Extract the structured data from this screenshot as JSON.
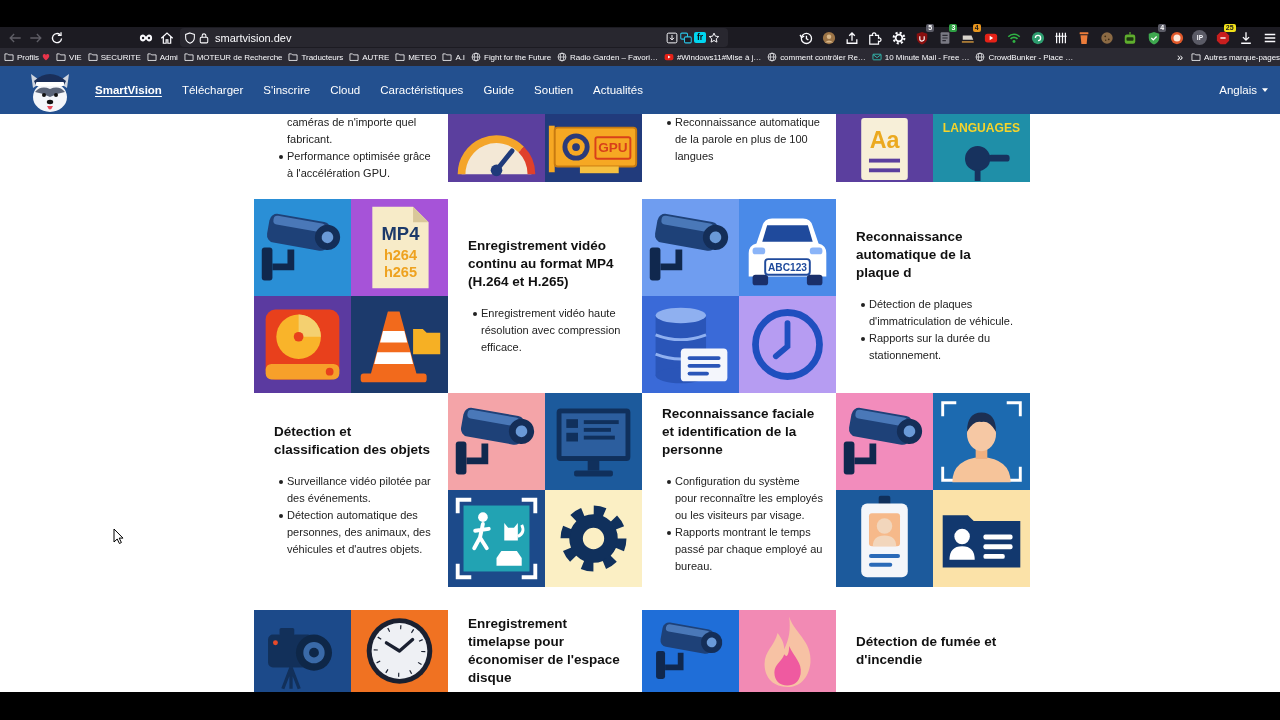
{
  "browser": {
    "toolbar": {
      "nav_buttons": [
        {
          "kind": "back",
          "disabled": true
        },
        {
          "kind": "forward",
          "disabled": true
        },
        {
          "kind": "reload",
          "disabled": false
        }
      ],
      "address": {
        "url": "smartvision.dev",
        "language_badge": "fr"
      },
      "extensions": [
        {
          "kind": "history"
        },
        {
          "kind": "avatar"
        },
        {
          "kind": "upload"
        },
        {
          "kind": "puzzle"
        },
        {
          "kind": "gear"
        },
        {
          "kind": "shield",
          "badge": {
            "text": "5",
            "color": "#5b5b66"
          }
        },
        {
          "kind": "document",
          "badge": {
            "text": "3",
            "color": "#2ea043"
          }
        },
        {
          "kind": "sled",
          "badge": {
            "text": "4",
            "color": "#e8961e"
          }
        },
        {
          "kind": "play"
        },
        {
          "kind": "wifi"
        },
        {
          "kind": "refresh"
        },
        {
          "kind": "bars"
        },
        {
          "kind": "trash"
        },
        {
          "kind": "cookie"
        },
        {
          "kind": "robot"
        },
        {
          "kind": "shieldcheck",
          "badge": {
            "text": "4",
            "color": "#5b5b66"
          }
        },
        {
          "kind": "ring"
        },
        {
          "kind": "text",
          "text": "IP"
        },
        {
          "kind": "stop",
          "badge": {
            "text": "25",
            "color": "#f2e21a"
          }
        },
        {
          "kind": "download"
        },
        {
          "kind": "menu"
        }
      ]
    },
    "bookmarks": {
      "items": [
        {
          "kind": "markedfolder",
          "label": "Profils"
        },
        {
          "kind": "folder",
          "label": "VIE"
        },
        {
          "kind": "folder",
          "label": "SECURITE"
        },
        {
          "kind": "folder",
          "label": "Admi"
        },
        {
          "kind": "folder",
          "label": "MOTEUR de Recherche"
        },
        {
          "kind": "folder",
          "label": "Traducteurs"
        },
        {
          "kind": "folder",
          "label": "AUTRE"
        },
        {
          "kind": "folder",
          "label": "METEO"
        },
        {
          "kind": "folder",
          "label": "A.I"
        },
        {
          "kind": "globe",
          "label": "Fight for the Future"
        },
        {
          "kind": "globe",
          "label": "Radio Garden – Favori…"
        },
        {
          "kind": "video",
          "label": "#Windows11#Mise à j…"
        },
        {
          "kind": "globe",
          "label": "comment contrôler Re…"
        },
        {
          "kind": "mail",
          "label": "10 Minute Mail - Free …"
        },
        {
          "kind": "globe",
          "label": "CrowdBunker - Place …"
        }
      ],
      "overflow": "»",
      "other_folder": "Autres marque-pages"
    }
  },
  "site": {
    "nav": {
      "items": [
        {
          "label": "SmartVision",
          "selected": true
        },
        {
          "label": "Télécharger",
          "selected": false
        },
        {
          "label": "S'inscrire",
          "selected": false
        },
        {
          "label": "Cloud",
          "selected": false
        },
        {
          "label": "Caractéristiques",
          "selected": false
        },
        {
          "label": "Guide",
          "selected": false
        },
        {
          "label": "Soutien",
          "selected": false
        },
        {
          "label": "Actualités",
          "selected": false
        }
      ],
      "language": "Anglais"
    },
    "feature_rows": [
      {
        "cells": [
          {
            "kind": "text",
            "continued": "caméras de n'importe quel fabricant.",
            "bullets": [
              "Performance optimisée grâce à l'accélération GPU."
            ]
          },
          {
            "kind": "image",
            "tiles": [
              {
                "kind": "gauge",
                "color": "#5b3f9e"
              },
              {
                "kind": "gpu",
                "color": "#213b7c",
                "texts": [
                  "GPU"
                ]
              }
            ]
          },
          {
            "kind": "text",
            "bullets": [
              "Reconnaissance automatique de la parole en plus de 100 langues"
            ]
          },
          {
            "kind": "image",
            "tiles": [
              {
                "kind": "document",
                "color": "#5b3f9e",
                "texts": [
                  "Aa"
                ]
              },
              {
                "kind": "microphone",
                "color": "#1f8fa8",
                "texts": [
                  "LANGUAGES"
                ]
              }
            ]
          }
        ]
      },
      {
        "cells": [
          {
            "kind": "image",
            "tiles": [
              {
                "kind": "camera",
                "color": "#2a8fd6"
              },
              {
                "kind": "file",
                "color": "#a653d8",
                "texts": [
                  "MP4",
                  "h264",
                  "h265"
                ]
              },
              {
                "kind": "harddrive",
                "color": "#5b3aa0"
              },
              {
                "kind": "cone",
                "color": "#1c3a6c"
              }
            ]
          },
          {
            "kind": "text",
            "title": "Enregistrement vidéo continu au format MP4 (H.264 et H.265)",
            "bullets": [
              "Enregistrement vidéo haute résolution avec compression efficace."
            ]
          },
          {
            "kind": "image",
            "tiles": [
              {
                "kind": "camera",
                "color": "#6f9df0"
              },
              {
                "kind": "car",
                "color": "#4a8ae8",
                "texts": [
                  "ABC123"
                ]
              },
              {
                "kind": "database",
                "color": "#3a6ad8"
              },
              {
                "kind": "clock",
                "color": "#b69cf2"
              }
            ]
          },
          {
            "kind": "text",
            "title": "Reconnaissance automatique de la plaque d",
            "bullets": [
              "Détection de plaques d'immatriculation de véhicule.",
              "Rapports sur la durée du stationnement."
            ]
          }
        ]
      },
      {
        "cells": [
          {
            "kind": "text",
            "title": "Détection et classification des objets",
            "bullets": [
              "Surveillance vidéo pilotée par des événements.",
              "Détection automatique des personnes, des animaux, des véhicules et d'autres objets."
            ]
          },
          {
            "kind": "image",
            "tiles": [
              {
                "kind": "camera",
                "color": "#f4a4a8"
              },
              {
                "kind": "monitor",
                "color": "#1c5a9c"
              },
              {
                "kind": "detection",
                "color": "#1c4a8a"
              },
              {
                "kind": "gear",
                "color": "#fbefc4"
              }
            ]
          },
          {
            "kind": "text",
            "title": "Reconnaissance faciale et identification de la personne",
            "bullets": [
              "Configuration du système pour reconnaître les employés ou les visiteurs par visage.",
              "Rapports montrant le temps passé par chaque employé au bureau."
            ]
          },
          {
            "kind": "image",
            "tiles": [
              {
                "kind": "camera",
                "color": "#f28cbc"
              },
              {
                "kind": "personscan",
                "color": "#1c6ab0"
              },
              {
                "kind": "idbadge",
                "color": "#1c5a9c"
              },
              {
                "kind": "contact",
                "color": "#fbe2a8"
              }
            ]
          }
        ]
      },
      {
        "cells": [
          {
            "kind": "image",
            "tiles": [
              {
                "kind": "videocam",
                "color": "#1c4a8a"
              },
              {
                "kind": "wallclock",
                "color": "#f07222"
              }
            ]
          },
          {
            "kind": "text",
            "title": "Enregistrement timelapse pour économiser de l'espace disque"
          },
          {
            "kind": "image",
            "tiles": [
              {
                "kind": "camera",
                "color": "#1f6ed8"
              },
              {
                "kind": "flame",
                "color": "#f28ab4"
              }
            ]
          },
          {
            "kind": "text",
            "title": "Détection de fumée et d'incendie"
          }
        ]
      }
    ]
  }
}
